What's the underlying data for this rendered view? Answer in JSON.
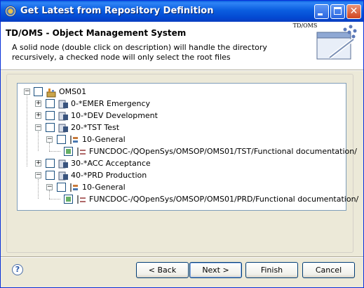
{
  "window": {
    "title": "Get Latest from Repository Definition"
  },
  "header": {
    "title": "TD/OMS - Object Management System",
    "description": "A solid node (double click on description) will handle the directory recursively, a checked node will only select the root files",
    "banner_label": "TD/OMS"
  },
  "tree": {
    "nodes": [
      {
        "label": "OMS01",
        "icon": "environment-icon",
        "checked": false
      },
      {
        "label": "0-*EMER Emergency",
        "icon": "level-icon",
        "checked": false
      },
      {
        "label": "10-*DEV Development",
        "icon": "level-icon",
        "checked": false
      },
      {
        "label": "20-*TST Test",
        "icon": "level-icon",
        "checked": false
      },
      {
        "label": "10-General",
        "icon": "component-icon",
        "checked": false
      },
      {
        "label": "FUNCDOC-/QOpenSys/OMSOP/OMS01/TST/Functional documentation/",
        "icon": "directory-icon",
        "checked": true
      },
      {
        "label": "30-*ACC Acceptance",
        "icon": "level-icon",
        "checked": false
      },
      {
        "label": "40-*PRD Production",
        "icon": "level-icon",
        "checked": false
      },
      {
        "label": "10-General",
        "icon": "component-icon",
        "checked": false
      },
      {
        "label": "FUNCDOC-/QOpenSys/OMSOP/OMS01/PRD/Functional documentation/",
        "icon": "directory-icon",
        "checked": true
      }
    ]
  },
  "buttons": {
    "back": "< Back",
    "next": "Next >",
    "finish": "Finish",
    "cancel": "Cancel"
  },
  "icons": {
    "help": "?"
  }
}
